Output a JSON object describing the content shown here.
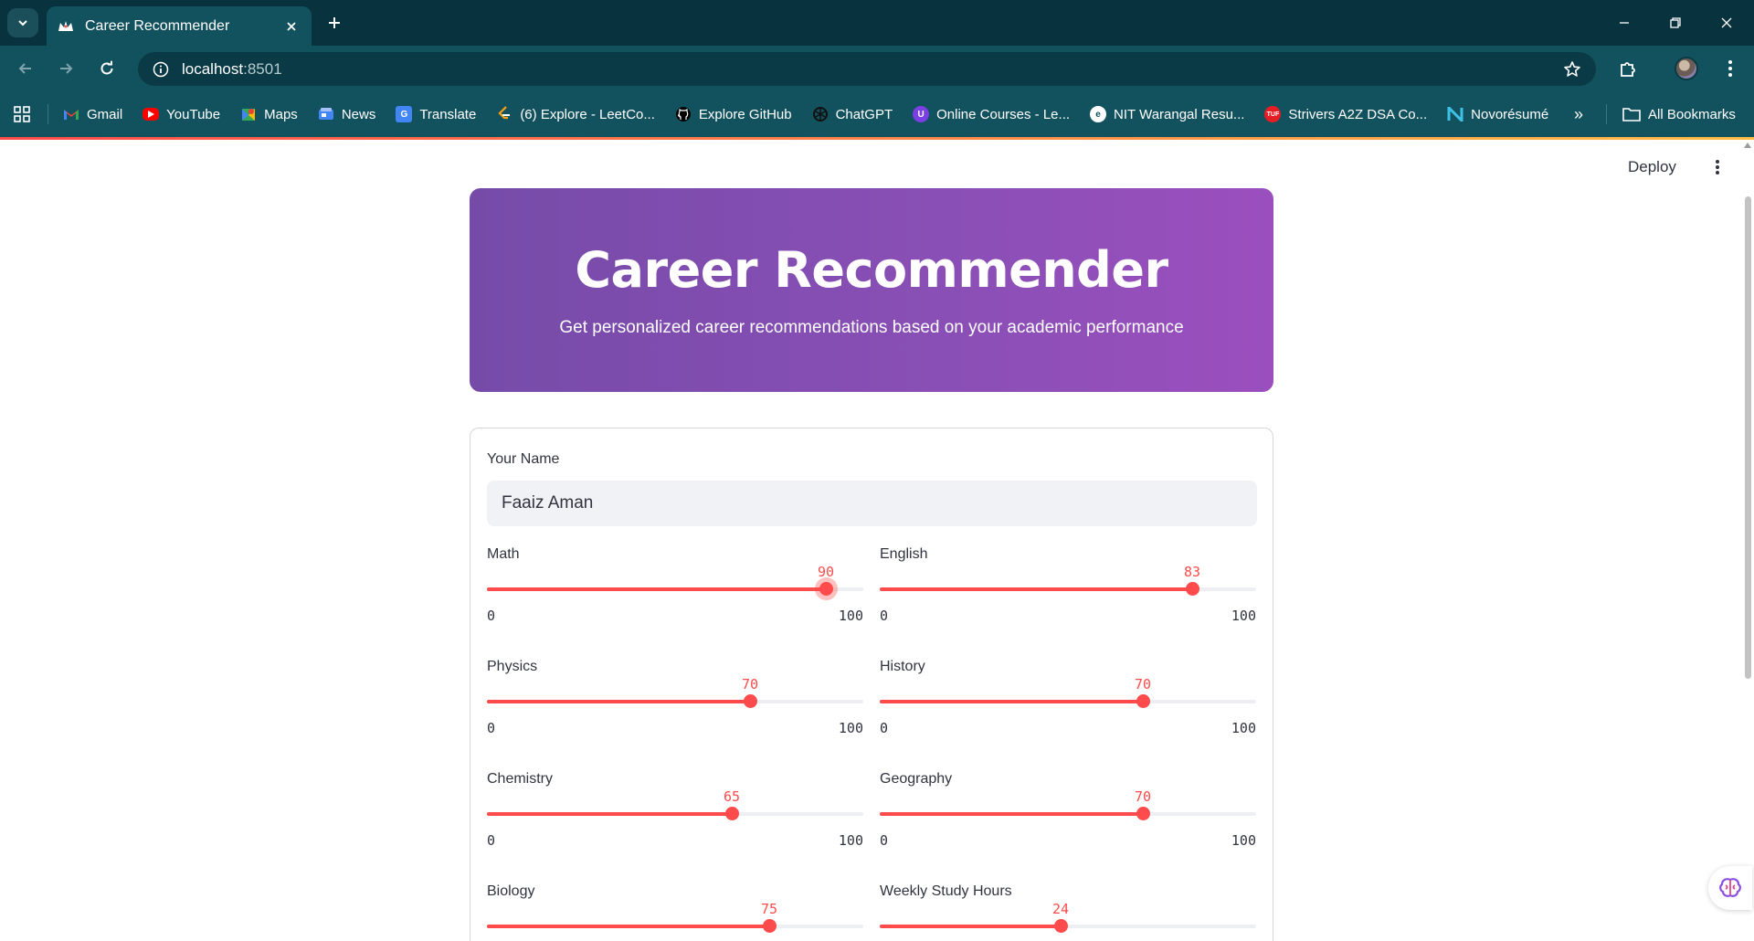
{
  "browser": {
    "tab_title": "Career Recommender",
    "url_host": "localhost",
    "url_port": ":8501",
    "bookmarks": [
      {
        "label": "Gmail",
        "icon": "gmail-icon"
      },
      {
        "label": "YouTube",
        "icon": "youtube-icon"
      },
      {
        "label": "Maps",
        "icon": "maps-icon"
      },
      {
        "label": "News",
        "icon": "news-icon"
      },
      {
        "label": "Translate",
        "icon": "translate-icon"
      },
      {
        "label": "(6) Explore - LeetCo...",
        "icon": "leetcode-icon"
      },
      {
        "label": "Explore GitHub",
        "icon": "github-icon"
      },
      {
        "label": "ChatGPT",
        "icon": "chatgpt-icon"
      },
      {
        "label": "Online Courses - Le...",
        "icon": "courses-icon"
      },
      {
        "label": "NIT Warangal Resu...",
        "icon": "nitw-icon"
      },
      {
        "label": "Strivers A2Z DSA Co...",
        "icon": "tuf-icon"
      },
      {
        "label": "Novorésumé",
        "icon": "novoresume-icon"
      }
    ],
    "all_bookmarks": "All Bookmarks",
    "more_bookmarks": "»"
  },
  "app": {
    "deploy_label": "Deploy",
    "hero": {
      "title": "Career Recommender",
      "subtitle": "Get personalized career recommendations based on your academic performance"
    },
    "form": {
      "name_label": "Your Name",
      "name_value": "Faaiz Aman",
      "sliders": [
        {
          "label": "Math",
          "value": 90,
          "min": 0,
          "max": 100,
          "focused": true
        },
        {
          "label": "English",
          "value": 83,
          "min": 0,
          "max": 100,
          "focused": false
        },
        {
          "label": "Physics",
          "value": 70,
          "min": 0,
          "max": 100,
          "focused": false
        },
        {
          "label": "History",
          "value": 70,
          "min": 0,
          "max": 100,
          "focused": false
        },
        {
          "label": "Chemistry",
          "value": 65,
          "min": 0,
          "max": 100,
          "focused": false
        },
        {
          "label": "Geography",
          "value": 70,
          "min": 0,
          "max": 100,
          "focused": false
        },
        {
          "label": "Biology",
          "value": 75,
          "min": 0,
          "max": 100,
          "focused": false
        },
        {
          "label": "Weekly Study Hours",
          "value": 24,
          "min": 0,
          "max": 50,
          "focused": false
        }
      ]
    }
  },
  "colors": {
    "accent": "#ff4b4b",
    "hero_start": "#764ba8",
    "hero_end": "#9b4fbe",
    "chrome_dark": "#08333e",
    "chrome": "#12525e"
  }
}
